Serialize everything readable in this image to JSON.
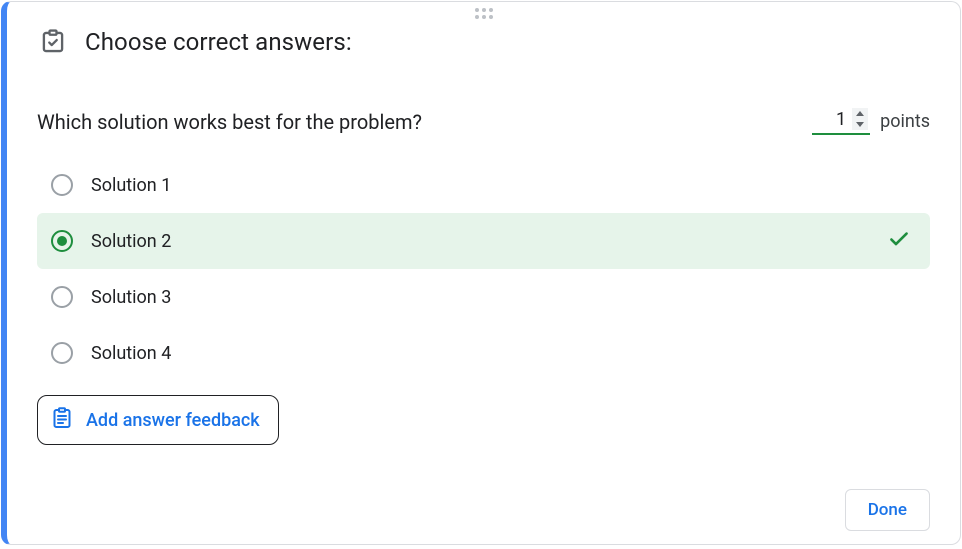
{
  "header": {
    "title": "Choose correct answers:"
  },
  "question": {
    "text": "Which solution works best for the problem?"
  },
  "points": {
    "value": "1",
    "label": "points"
  },
  "options": [
    {
      "label": "Solution 1",
      "selected": false
    },
    {
      "label": "Solution 2",
      "selected": true
    },
    {
      "label": "Solution 3",
      "selected": false
    },
    {
      "label": "Solution 4",
      "selected": false
    }
  ],
  "feedback": {
    "button_label": "Add answer feedback"
  },
  "footer": {
    "done_label": "Done"
  }
}
